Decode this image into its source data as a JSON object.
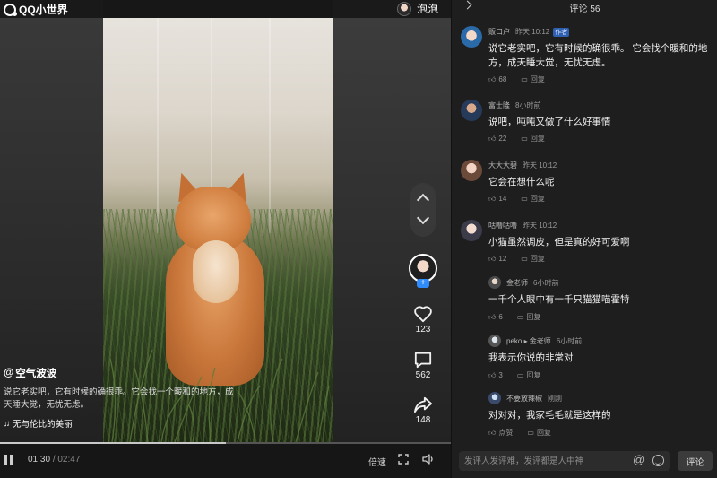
{
  "app": {
    "logo_text": "QQ小世界",
    "user_name": "泡泡"
  },
  "video": {
    "author": "空气波波",
    "description": "说它老实吧，它有时候的确很乖。它会找一个暖和的地方，成天睡大觉，无忧无虑。",
    "music": "无与伦比的美丽",
    "likes": "123",
    "comments": "562",
    "shares": "148",
    "current_time": "01:30",
    "separator": "/",
    "total_time": "02:47",
    "progress": 0.5,
    "speed_label": "倍速"
  },
  "comments_panel": {
    "title": "评论 56",
    "items": [
      {
        "name": "贩口卢",
        "time": "昨天 10:12",
        "badge": "作者",
        "text": "说它老实吧，它有时候的确很乖。 它会找个暖和的地方，成天睡大觉，无忧无虑。",
        "likes": "68",
        "reply_label": "回复"
      },
      {
        "name": "富士隆",
        "time": "8小时前",
        "text": "说吧，吨吨又做了什么好事情",
        "likes": "22",
        "reply_label": "回复"
      },
      {
        "name": "大大大碧",
        "time": "昨天 10:12",
        "text": "它会在想什么呢",
        "likes": "14",
        "reply_label": "回复"
      },
      {
        "name": "咕噜咕噜",
        "time": "昨天 10:12",
        "text": "小猫虽然调皮，但是真的好可爱啊",
        "likes": "12",
        "reply_label": "回复"
      }
    ],
    "replies": [
      {
        "name": "金老师",
        "time": "6小时前",
        "text": "一千个人眼中有一千只猫猫喵霍特",
        "likes": "6",
        "reply_label": "回复"
      },
      {
        "name": "peko ▸ 金老师",
        "time": "6小时前",
        "text": "我表示你说的非常对",
        "likes": "3",
        "reply_label": "回复"
      },
      {
        "name": "不要放辣椒",
        "time": "刚刚",
        "text": "对对对，我家毛毛就是这样的",
        "likes": "点赞",
        "reply_label": "回复"
      }
    ],
    "input_placeholder": "发评人发评难，发评都是人中神",
    "submit_label": "评论"
  },
  "colors": {
    "accent_blue": "#2f8cff",
    "badge_blue": "#2f5fae",
    "panel_bg": "#1e1e1e"
  }
}
